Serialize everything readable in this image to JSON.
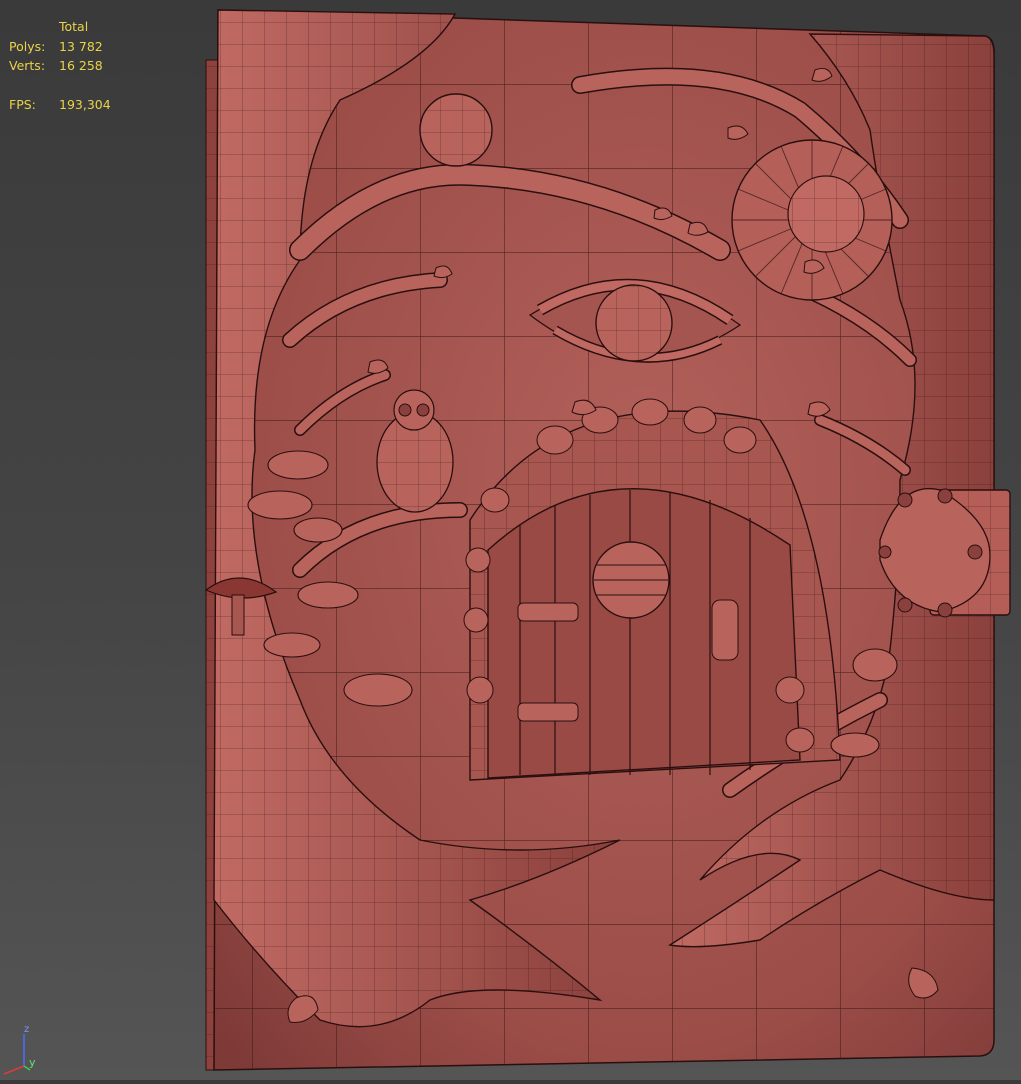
{
  "stats": {
    "header": "Total",
    "polys_label": "Polys:",
    "polys_value": "13 782",
    "verts_label": "Verts:",
    "verts_value": "16 258",
    "fps_label": "FPS:",
    "fps_value": "193,304"
  },
  "axis": {
    "z_label": "z",
    "y_label": "y"
  },
  "colors": {
    "stats_text": "#e8d34a",
    "model_base": "#a85650",
    "model_light": "#c8716a",
    "model_dark": "#6e2e2c",
    "wire": "#2a0f0f",
    "background": "#454545"
  }
}
